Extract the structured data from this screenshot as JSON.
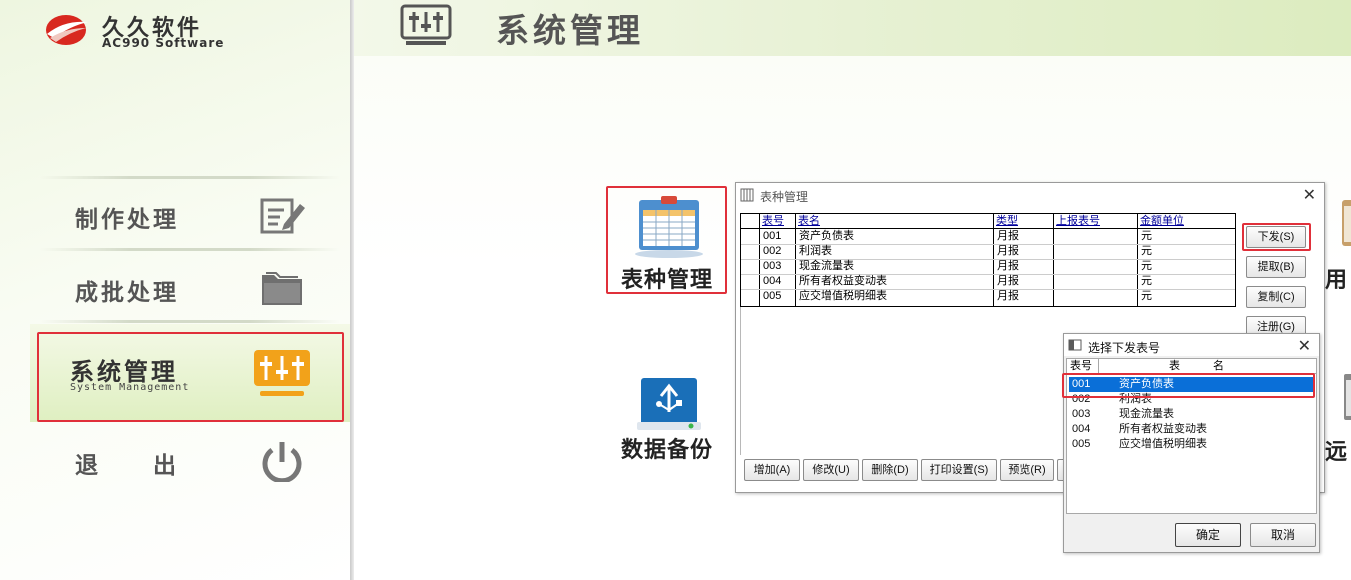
{
  "brand": {
    "name_cn": "久久软件",
    "name_en": "AC990 Software"
  },
  "header": {
    "title": "系统管理"
  },
  "sidebar": {
    "items": [
      {
        "label": "制作处理",
        "icon": "edit-icon"
      },
      {
        "label": "成批处理",
        "icon": "folder-icon"
      },
      {
        "label": "系统管理",
        "sublabel": "System Management",
        "icon": "sliders-icon",
        "active": true
      },
      {
        "label": "退　　出",
        "icon": "power-icon"
      }
    ]
  },
  "tiles": [
    {
      "label": "表种管理",
      "icon": "report-table-icon"
    },
    {
      "label": "数据备份",
      "icon": "usb-backup-icon"
    }
  ],
  "edge_labels": {
    "right_top": "用",
    "right_bottom": "远"
  },
  "table_dialog": {
    "title": "表种管理",
    "columns": [
      "表号",
      "表名",
      "类型",
      "上报表号",
      "金额单位"
    ],
    "rows": [
      {
        "id": "001",
        "name": "资产负债表",
        "type": "月报",
        "report_no": "",
        "unit": "元"
      },
      {
        "id": "002",
        "name": "利润表",
        "type": "月报",
        "report_no": "",
        "unit": "元"
      },
      {
        "id": "003",
        "name": "现金流量表",
        "type": "月报",
        "report_no": "",
        "unit": "元"
      },
      {
        "id": "004",
        "name": "所有者权益变动表",
        "type": "月报",
        "report_no": "",
        "unit": "元"
      },
      {
        "id": "005",
        "name": "应交增值税明细表",
        "type": "月报",
        "report_no": "",
        "unit": "元"
      }
    ],
    "side_buttons": [
      "下发(S)",
      "提取(B)",
      "复制(C)",
      "注册(G)"
    ],
    "bottom_buttons": [
      "增加(A)",
      "修改(U)",
      "删除(D)",
      "打印设置(S)",
      "预览(R)"
    ]
  },
  "select_dialog": {
    "title": "选择下发表号",
    "col_id": "表号",
    "col_name": "表　　　名",
    "rows": [
      {
        "id": "001",
        "name": "资产负债表",
        "selected": true
      },
      {
        "id": "002",
        "name": "利润表"
      },
      {
        "id": "003",
        "name": "现金流量表"
      },
      {
        "id": "004",
        "name": "所有者权益变动表"
      },
      {
        "id": "005",
        "name": "应交增值税明细表"
      }
    ],
    "ok_label": "确定",
    "cancel_label": "取消"
  },
  "colors": {
    "highlight_red": "#e0303a",
    "selection_blue": "#0a6fd8",
    "header_green": "#dcecbf",
    "icon_orange": "#f2a21a"
  }
}
